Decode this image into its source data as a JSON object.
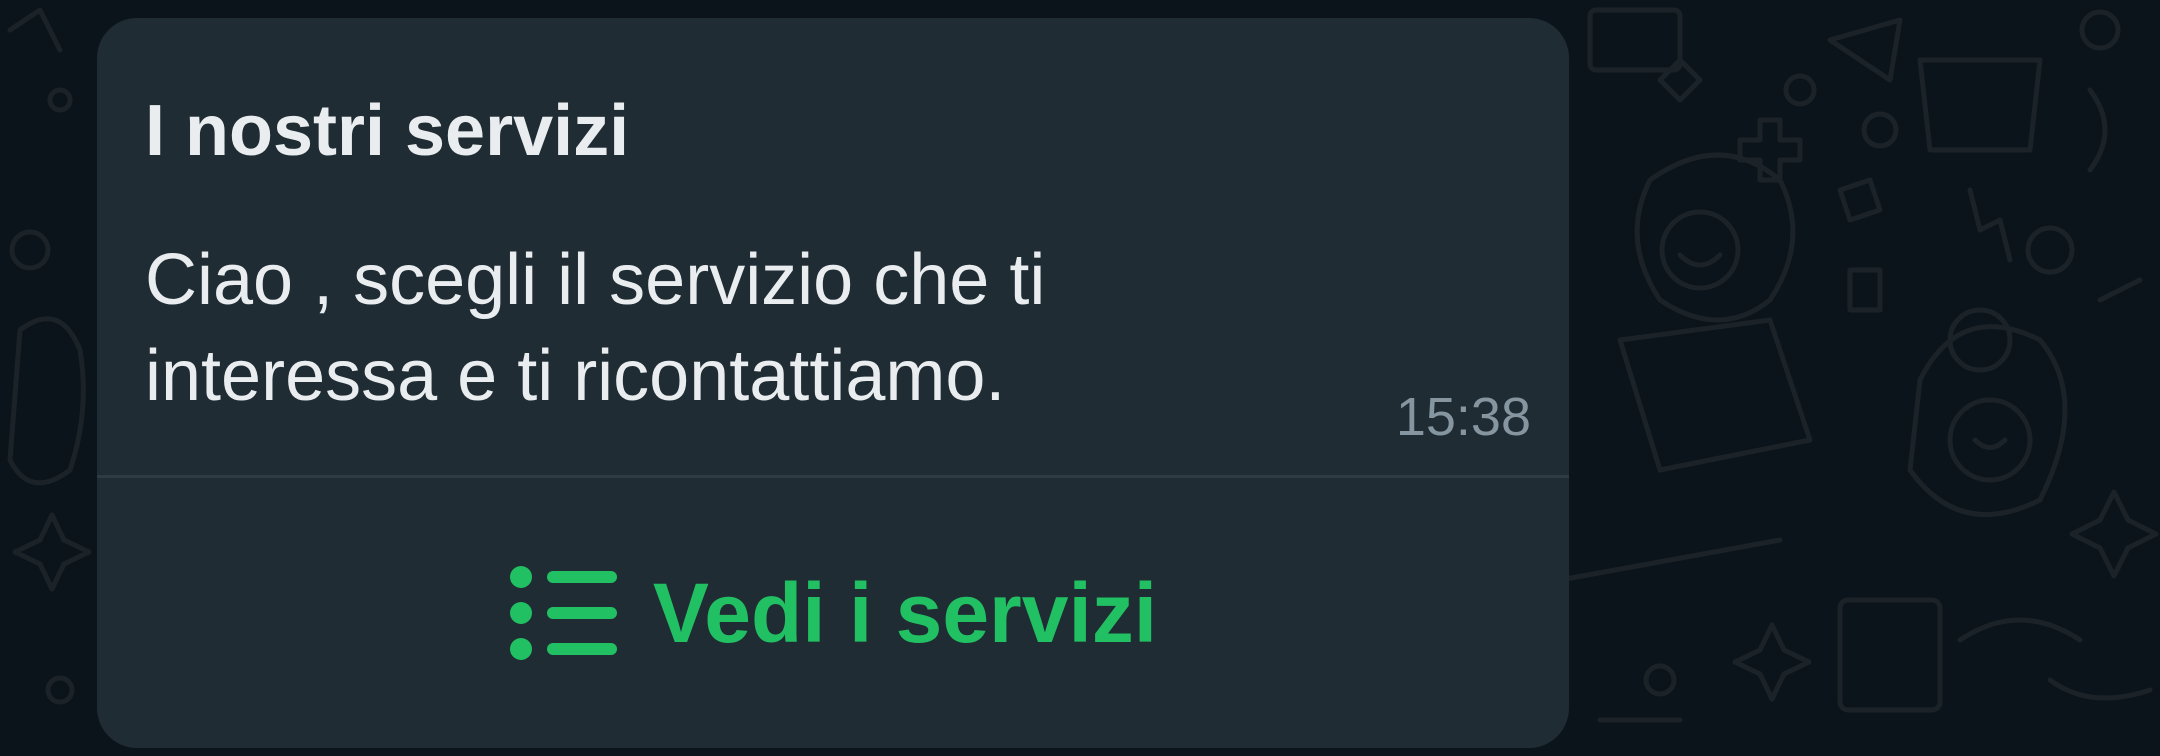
{
  "colors": {
    "chat_background": "#0b141a",
    "bubble_background": "#202c33",
    "primary_text": "#e9edef",
    "secondary_text": "#8696a0",
    "accent": "#21c063",
    "divider": "#2e3b43"
  },
  "message": {
    "title": "I nostri servizi",
    "body": "Ciao , scegli il servizio che ti\ninteressa e ti ricontattiamo.",
    "time": "15:38",
    "action": {
      "icon": "list-icon",
      "label": "Vedi i servizi"
    }
  }
}
